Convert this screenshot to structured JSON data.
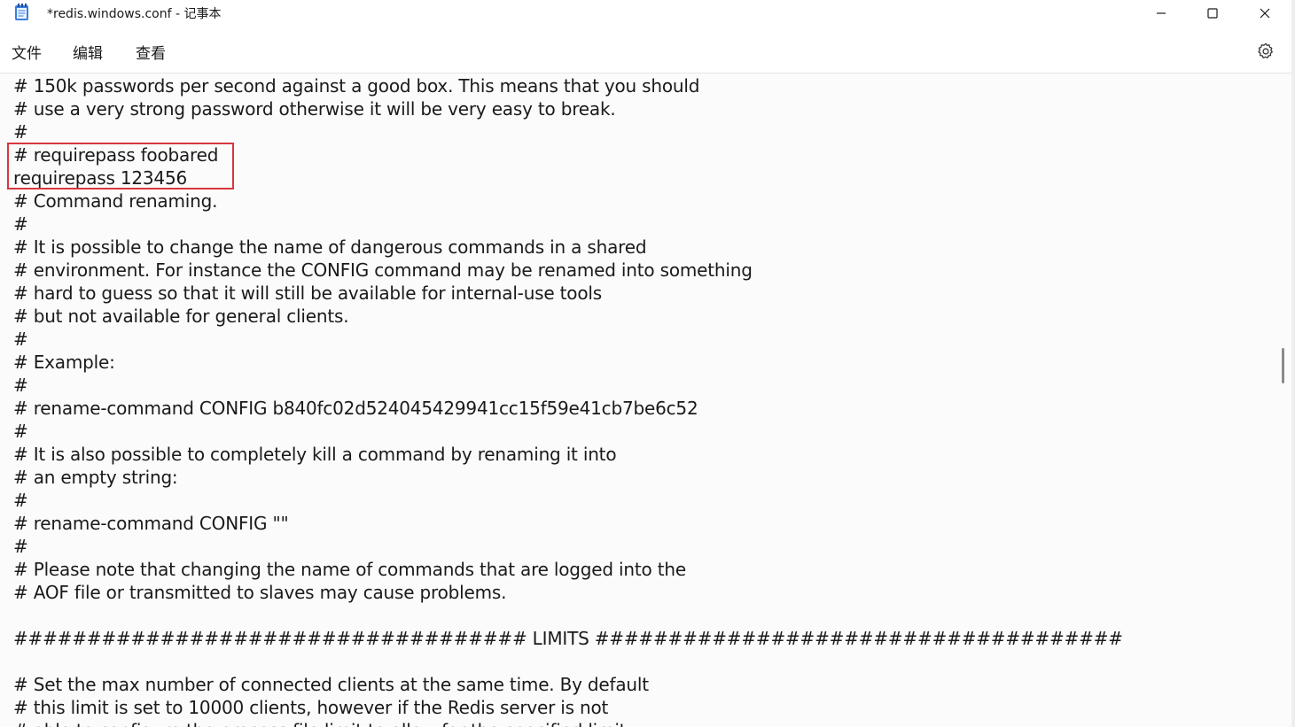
{
  "window": {
    "title": "*redis.windows.conf - 记事本",
    "app_icon": "notepad-icon",
    "controls": {
      "minimize_icon": "minimize-icon",
      "maximize_icon": "maximize-icon",
      "close_icon": "close-icon"
    }
  },
  "menu": {
    "file": "文件",
    "edit": "编辑",
    "view": "查看",
    "settings_icon": "gear-icon"
  },
  "colors": {
    "highlight_border": "#d9363e",
    "text": "#1a1a1a",
    "background": "#fbfbfb"
  },
  "editor": {
    "lines": [
      "# 150k passwords per second against a good box. This means that you should",
      "# use a very strong password otherwise it will be very easy to break.",
      "#",
      "# requirepass foobared",
      "requirepass 123456",
      "# Command renaming.",
      "#",
      "# It is possible to change the name of dangerous commands in a shared",
      "# environment. For instance the CONFIG command may be renamed into something",
      "# hard to guess so that it will still be available for internal-use tools",
      "# but not available for general clients.",
      "#",
      "# Example:",
      "#",
      "# rename-command CONFIG b840fc02d524045429941cc15f59e41cb7be6c52",
      "#",
      "# It is also possible to completely kill a command by renaming it into",
      "# an empty string:",
      "#",
      "# rename-command CONFIG \"\"",
      "#",
      "# Please note that changing the name of commands that are logged into the",
      "# AOF file or transmitted to slaves may cause problems.",
      "",
      "################################### LIMITS ####################################",
      "",
      "# Set the max number of connected clients at the same time. By default",
      "# this limit is set to 10000 clients, however if the Redis server is not",
      "# able to configure the process file limit to allow for the specified limit"
    ]
  }
}
